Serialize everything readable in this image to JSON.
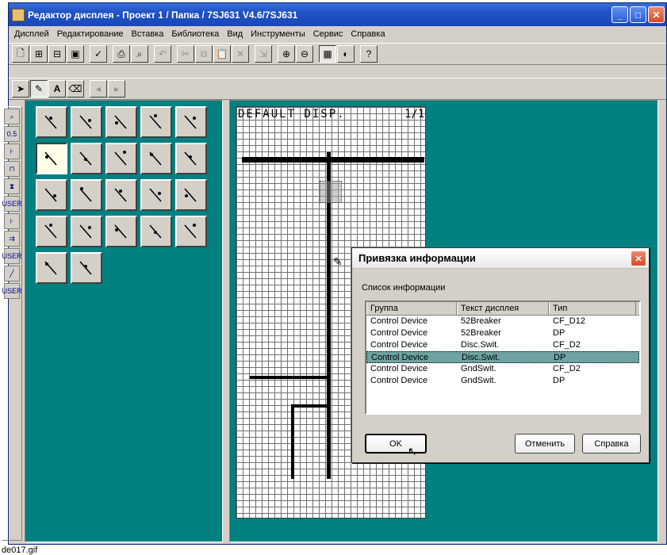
{
  "window": {
    "title": "Редактор дисплея - Проект 1 / Папка / 7SJ631 V4.6/7SJ631"
  },
  "menu": [
    "Дисплей",
    "Редактирование",
    "Вставка",
    "Библиотека",
    "Вид",
    "Инструменты",
    "Сервис",
    "Справка"
  ],
  "canvas": {
    "header": "DEFAULT DISP.",
    "page": "1/1"
  },
  "dialog": {
    "title": "Привязка информации",
    "list_label": "Список информации",
    "columns": [
      "Группа",
      "Текст дисплея",
      "Тип"
    ],
    "rows": [
      [
        "Control Device",
        "52Breaker",
        "CF_D12"
      ],
      [
        "Control Device",
        "52Breaker",
        "DP"
      ],
      [
        "Control Device",
        "Disc.Swit.",
        "CF_D2"
      ],
      [
        "Control Device",
        "Disc.Swit.",
        "DP"
      ],
      [
        "Control Device",
        "GndSwit.",
        "CF_D2"
      ],
      [
        "Control Device",
        "GndSwit.",
        "DP"
      ]
    ],
    "selected_row": 3,
    "ok": "OK",
    "cancel": "Отменить",
    "help": "Справка"
  },
  "left_tools": [
    "0.5",
    "USER",
    "USER",
    "USER"
  ],
  "footer": "de017.gif"
}
